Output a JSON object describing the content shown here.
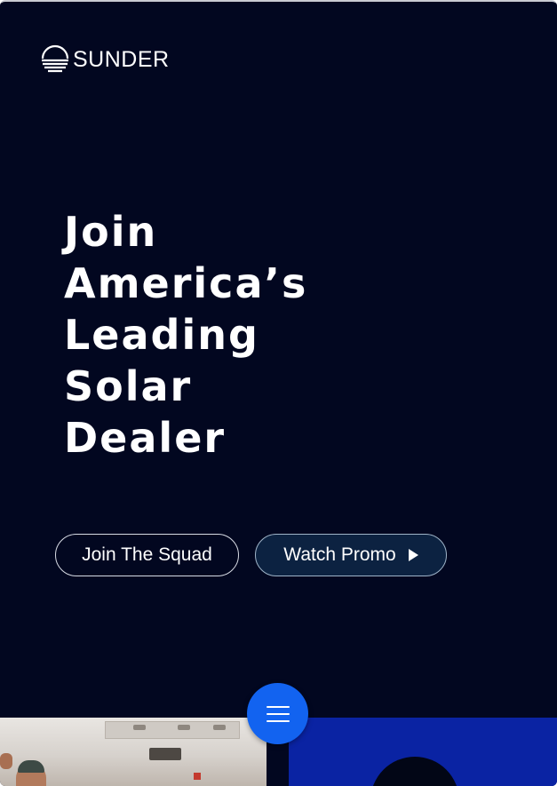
{
  "brand": {
    "name": "SUNDER",
    "logo_icon": "sun-horizon-icon"
  },
  "hero": {
    "title_lines": [
      "Join",
      "America’s",
      "Leading",
      "Solar",
      "Dealer"
    ]
  },
  "buttons": {
    "join_label": "Join The Squad",
    "watch_label": "Watch Promo",
    "watch_icon": "play-icon"
  },
  "menu": {
    "icon": "hamburger-menu-icon"
  },
  "colors": {
    "background": "#020720",
    "accent": "#1263f0",
    "strip_blue": "#0a23a3"
  }
}
